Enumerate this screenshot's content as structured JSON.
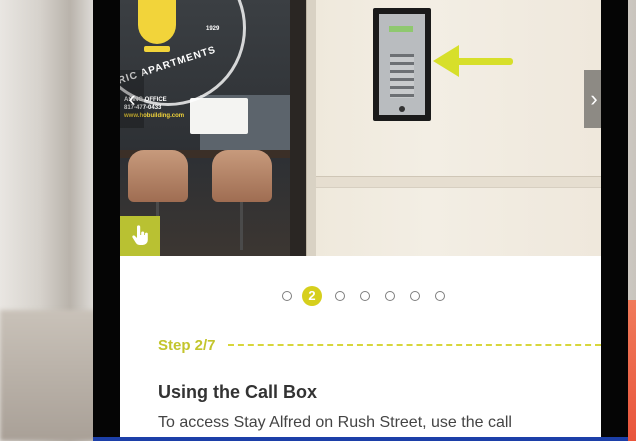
{
  "photo": {
    "est_text": "1929",
    "apartments_text": "RIC APARTMENTS",
    "leasing_text": "ASING OFFICE",
    "phone_text": "817-477-0433",
    "url_text": "www.hobuilding.com",
    "prev_label": "‹",
    "next_label": "›",
    "touch_icon": "hand-pointer-icon",
    "arrow_color": "#d7df2a"
  },
  "pager": {
    "active_label": "2",
    "active_index": 2,
    "total": 7
  },
  "step": {
    "label": "Step 2/7",
    "accent": "#c3c52c"
  },
  "content": {
    "title": "Using the Call Box",
    "body": "To access Stay Alfred on Rush Street, use the call"
  }
}
